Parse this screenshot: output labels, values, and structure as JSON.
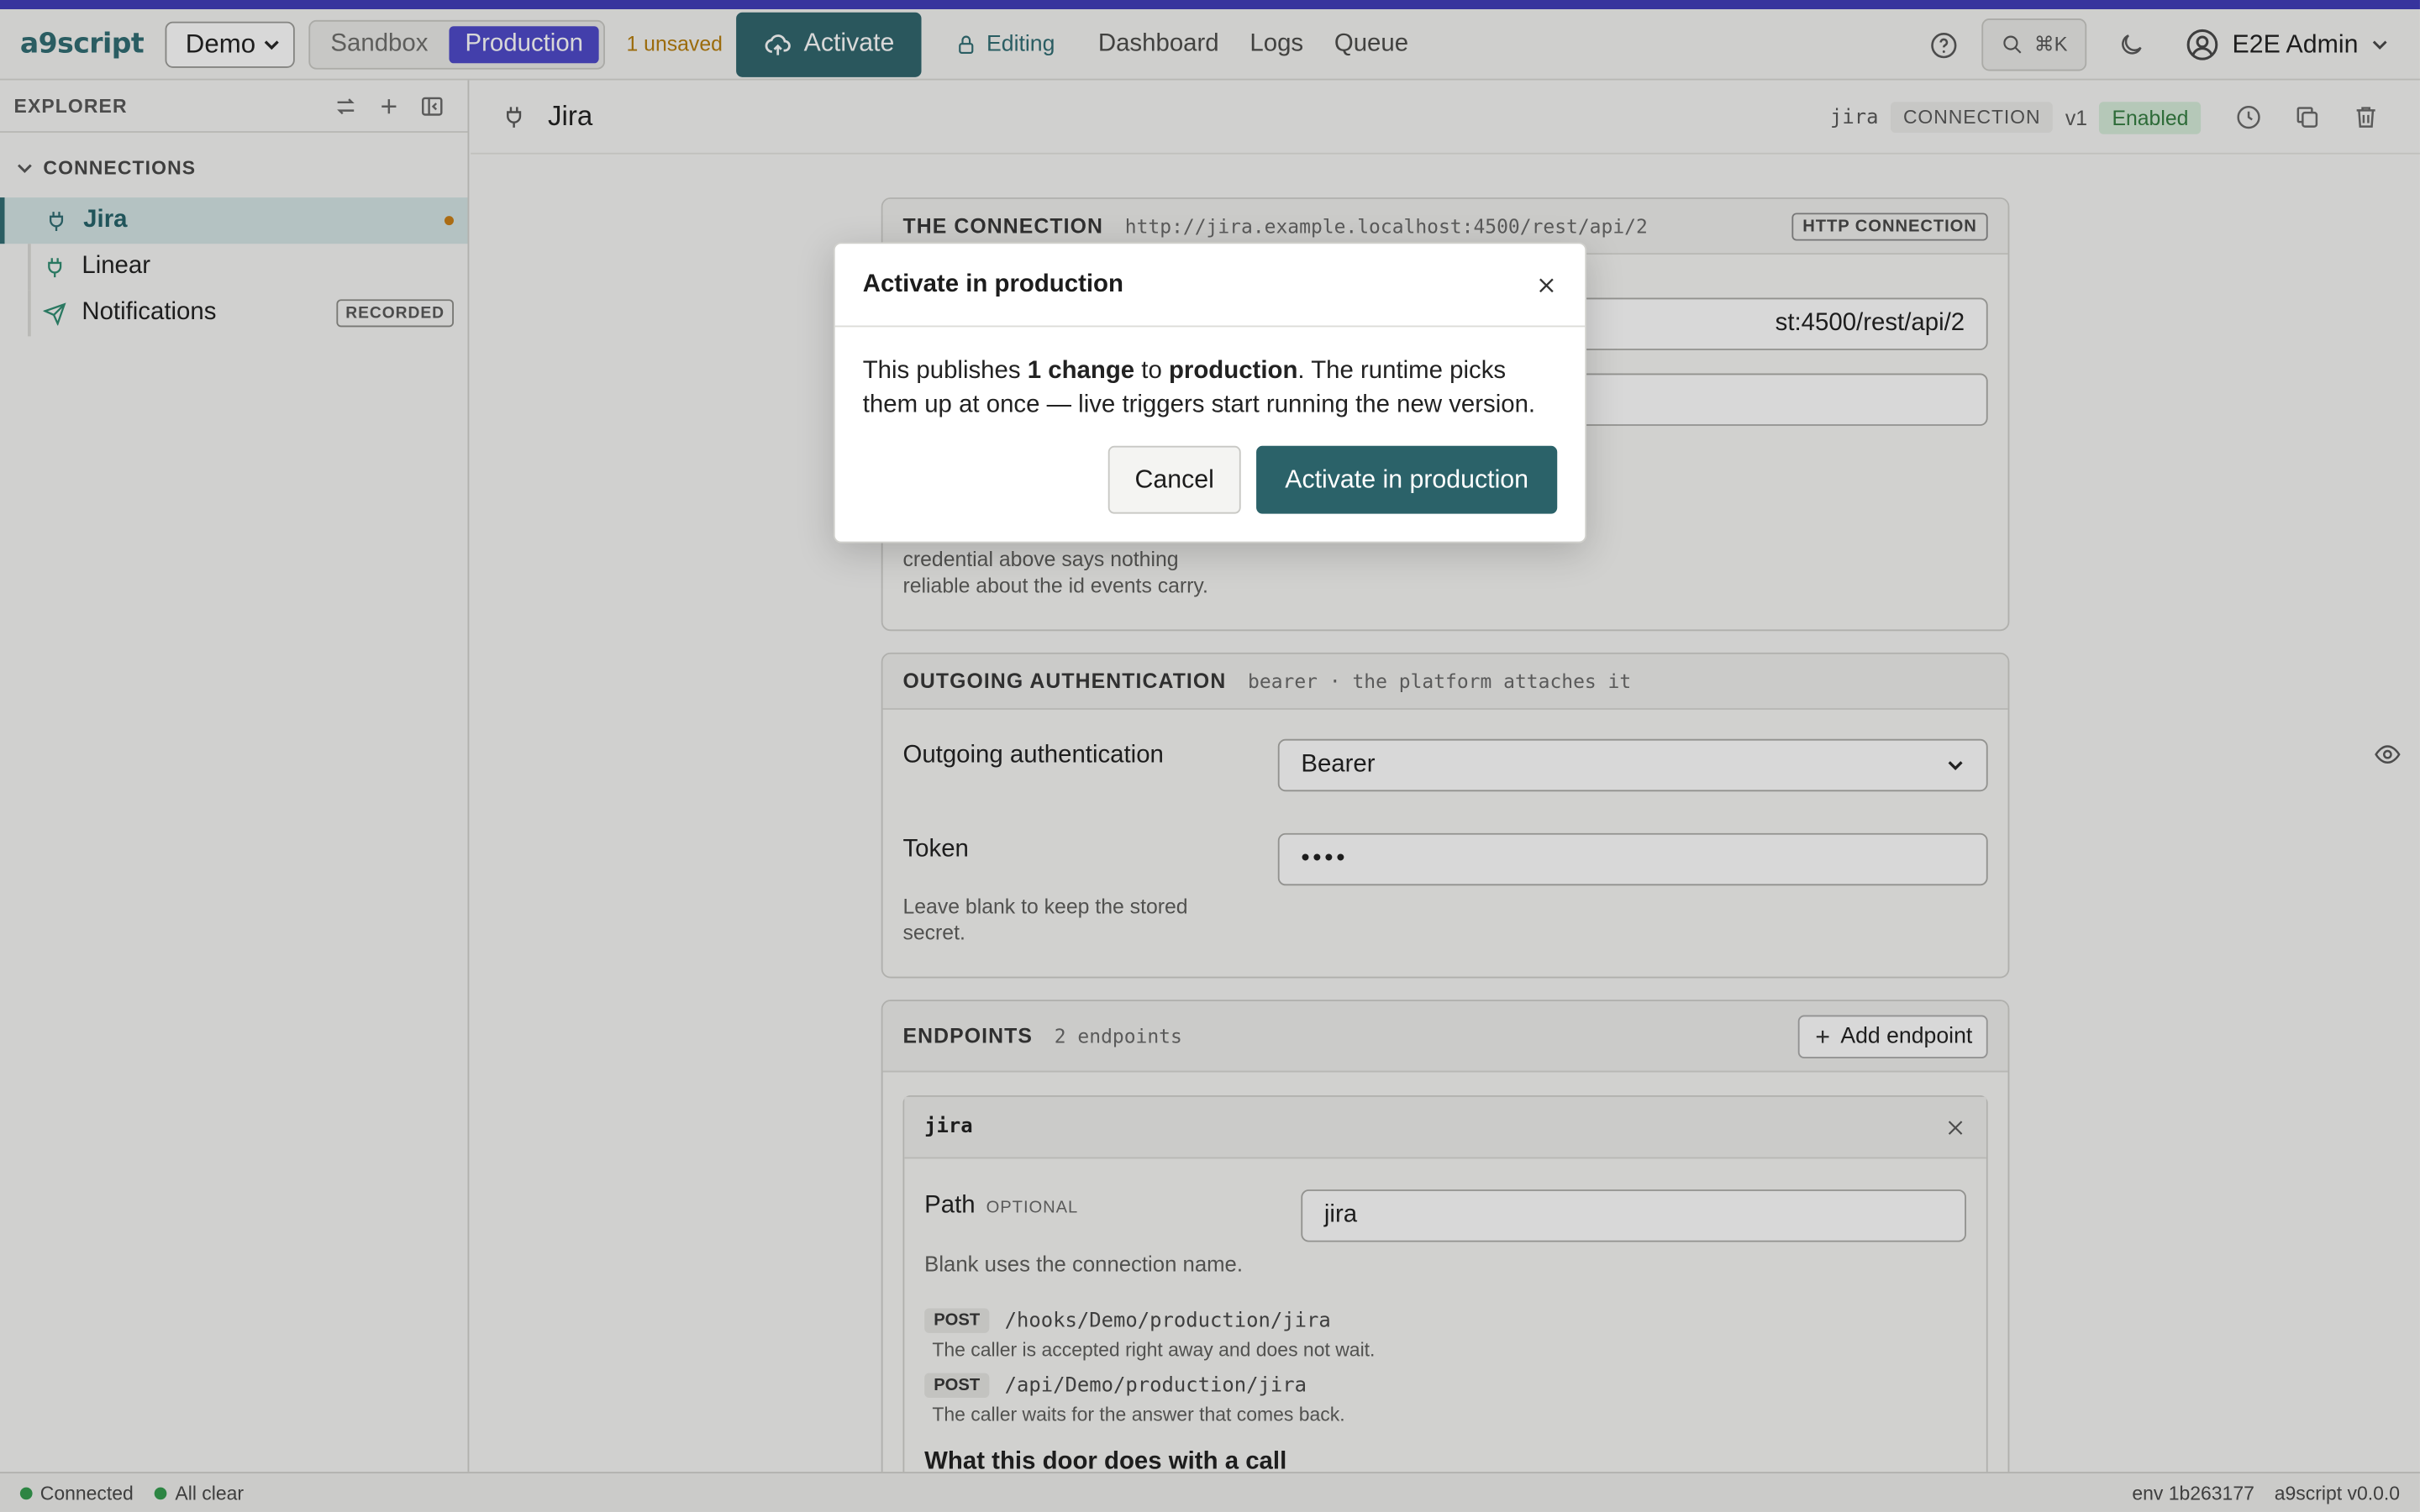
{
  "app": {
    "brand": "a9script",
    "workspace": "Demo",
    "env_sandbox": "Sandbox",
    "env_production": "Production",
    "unsaved": "1 unsaved",
    "activate": "Activate",
    "editing": "Editing",
    "nav": [
      "Dashboard",
      "Logs",
      "Queue"
    ],
    "search_shortcut": "⌘K",
    "user": "E2E Admin"
  },
  "sidebar": {
    "title": "EXPLORER",
    "group": "CONNECTIONS",
    "items": [
      {
        "label": "Jira",
        "selected": true,
        "unsaved": true
      },
      {
        "label": "Linear"
      },
      {
        "label": "Notifications",
        "badge": "RECORDED"
      }
    ]
  },
  "main": {
    "title": "Jira",
    "slug": "jira",
    "kind": "CONNECTION",
    "version": "v1",
    "status": "Enabled",
    "connection": {
      "heading": "THE CONNECTION",
      "url": "http://jira.example.localhost:4500/rest/api/2",
      "type_badge": "HTTP CONNECTION",
      "field_visible": "st:4500/rest/api/2",
      "help": "credential above says nothing reliable about the id events carry."
    },
    "outgoing": {
      "heading": "OUTGOING AUTHENTICATION",
      "sub": "bearer · the platform attaches it",
      "auth_label": "Outgoing authentication",
      "auth_value": "Bearer",
      "token_label": "Token",
      "token_value": "••••",
      "token_help": "Leave blank to keep the stored secret."
    },
    "endpoints": {
      "heading": "ENDPOINTS",
      "count": "2 endpoints",
      "add": "Add endpoint",
      "endpoint_name": "jira",
      "path_label": "Path",
      "path_optional": "OPTIONAL",
      "path_value": "jira",
      "path_help": "Blank uses the connection name.",
      "routes": [
        {
          "method": "POST",
          "path": "/hooks/Demo/production/jira",
          "desc": "The caller is accepted right away and does not wait."
        },
        {
          "method": "POST",
          "path": "/api/Demo/production/jira",
          "desc": "The caller waits for the answer that comes back."
        }
      ],
      "door_heading": "What this door does with a call"
    }
  },
  "modal": {
    "title": "Activate in production",
    "body_pre": "This publishes ",
    "body_count": "1 change",
    "body_mid": " to ",
    "body_env": "production",
    "body_post": ". The runtime picks them up at once — live triggers start running the new version.",
    "cancel": "Cancel",
    "confirm": "Activate in production"
  },
  "status": {
    "connected": "Connected",
    "clear": "All clear",
    "env": "env 1b263177",
    "version": "a9script v0.0.0"
  },
  "colors": {
    "accent": "#2b6269",
    "env_active": "#4a45c9",
    "stripe": "#3b37b8",
    "unsaved": "#b57a06"
  }
}
